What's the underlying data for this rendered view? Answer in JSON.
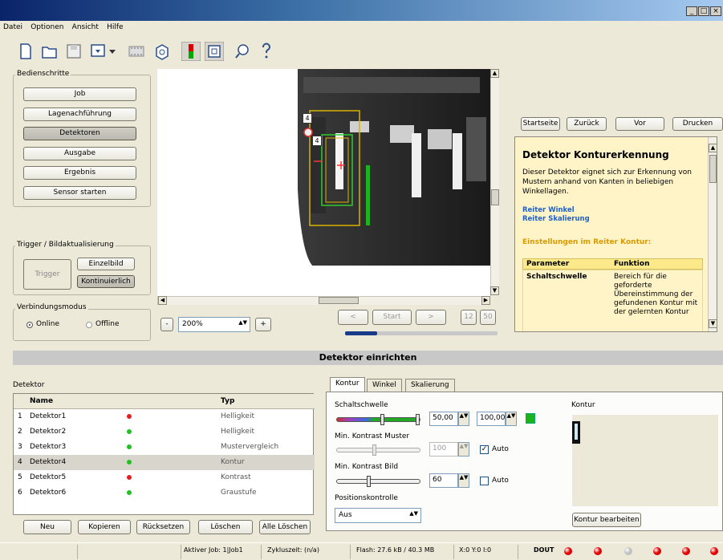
{
  "window": {
    "btn_min": "_",
    "btn_max": "□",
    "btn_close": "×"
  },
  "menu": [
    "Datei",
    "Optionen",
    "Ansicht",
    "Hilfe"
  ],
  "toolbar": {
    "icons": [
      "new-icon",
      "open-icon",
      "save-icon",
      "download-icon",
      "film-icon",
      "camera-icon",
      "traffic-light-icon",
      "view-icon",
      "search-icon",
      "help-icon"
    ]
  },
  "bedienschritte": {
    "title": "Bedienschritte",
    "buttons": [
      "Job",
      "Lagenachführung",
      "Detektoren",
      "Ausgabe",
      "Ergebnis",
      "Sensor starten"
    ],
    "active_index": 2
  },
  "trigger": {
    "title": "Trigger / Bildaktualisierung",
    "trigger_label": "Trigger",
    "single_label": "Einzelbild",
    "continuous_label": "Kontinuierlich"
  },
  "connection": {
    "title": "Verbindungsmodus",
    "online_label": "Online",
    "offline_label": "Offline",
    "selected": "Online"
  },
  "zoom": {
    "minus": "-",
    "value": "200%",
    "plus": "+"
  },
  "playback": {
    "prev": "<",
    "start": "Start",
    "next": ">",
    "val1": "12",
    "val2": "50"
  },
  "detector_overlay": {
    "label_outer": "4",
    "label_inner": "4"
  },
  "help_nav": {
    "home": "Startseite",
    "back": "Zurück",
    "forward": "Vor",
    "print": "Drucken"
  },
  "help": {
    "heading": "Detektor Konturerkennung",
    "intro": "Dieser Detektor eignet sich zur Erkennung von Mustern anhand von Kanten in beliebigen Winkellagen.",
    "link1": "Reiter Winkel",
    "link2": "Reiter Skalierung",
    "section": "Einstellungen im Reiter Kontur:",
    "col_param": "Parameter",
    "col_func": "Funktion",
    "row_param": "Schaltschwelle",
    "row_func": "Bereich für die geforderte Übereinstimmung der gefundenen Kontur mit der gelernten Kontur"
  },
  "section_title": "Detektor einrichten",
  "detector_list": {
    "title": "Detektor",
    "col_name": "Name",
    "col_type": "Typ",
    "rows": [
      {
        "num": "1",
        "name": "Detektor1",
        "status": "red",
        "type": "Helligkeit"
      },
      {
        "num": "2",
        "name": "Detektor2",
        "status": "green",
        "type": "Helligkeit"
      },
      {
        "num": "3",
        "name": "Detektor3",
        "status": "green",
        "type": "Mustervergleich"
      },
      {
        "num": "4",
        "name": "Detektor4",
        "status": "green",
        "type": "Kontur"
      },
      {
        "num": "5",
        "name": "Detektor5",
        "status": "red",
        "type": "Kontrast"
      },
      {
        "num": "6",
        "name": "Detektor6",
        "status": "green",
        "type": "Graustufe"
      }
    ],
    "selected_index": 3,
    "buttons": [
      "Neu",
      "Kopieren",
      "Rücksetzen",
      "Löschen",
      "Alle Löschen"
    ]
  },
  "tabs": [
    "Kontur",
    "Winkel",
    "Skalierung"
  ],
  "kontur": {
    "schaltschwelle_label": "Schaltschwelle",
    "schaltschwelle_min": "50,00",
    "schaltschwelle_max": "100,00",
    "kontrast_muster_label": "Min. Kontrast Muster",
    "kontrast_muster_value": "100",
    "auto_label": "Auto",
    "kontrast_bild_label": "Min. Kontrast Bild",
    "kontrast_bild_value": "60",
    "auto2_label": "Auto",
    "position_label": "Positionskontrolle",
    "position_value": "Aus",
    "preview_label": "Kontur",
    "edit_button": "Kontur bearbeiten"
  },
  "status": {
    "active_job": "Aktiver Job:  1|Job1",
    "cycle": "Zykluszeit:  (n/a)",
    "flash": "Flash:  27.6 kB / 40.3 MB",
    "coords": "X:0 Y:0 I:0",
    "dout": "DOUT",
    "leds": [
      "#e00000",
      "#e00000",
      "#c0c0c0",
      "#e00000",
      "#e00000",
      "#e00000"
    ]
  }
}
